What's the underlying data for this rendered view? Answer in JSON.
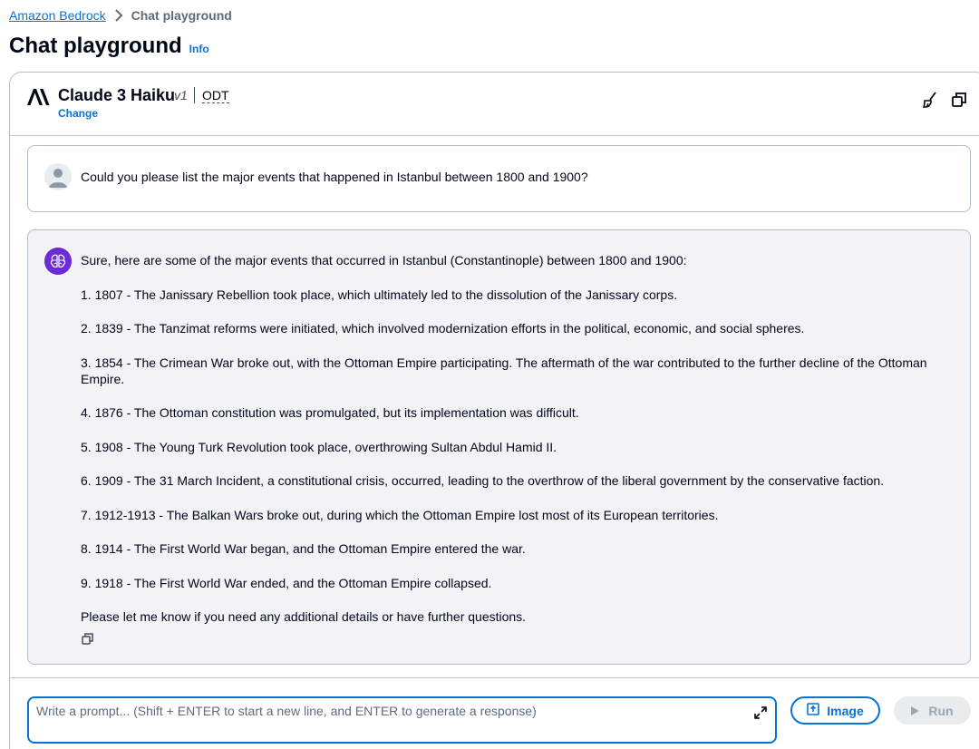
{
  "breadcrumb": {
    "parent": "Amazon Bedrock",
    "current": "Chat playground"
  },
  "page": {
    "title": "Chat playground",
    "info_label": "Info"
  },
  "model": {
    "name": "Claude 3 Haiku",
    "version": "v1",
    "tag": "ODT",
    "change_label": "Change",
    "icons": [
      "anthropic-logo",
      "broom-clear-icon",
      "copy-icon"
    ]
  },
  "conversation": {
    "user_message": "Could you please list the major events that happened in Istanbul between 1800 and 1900?",
    "assistant_intro": "Sure, here are some of the major events that occurred in Istanbul (Constantinople) between 1800 and 1900:",
    "assistant_items": [
      "1. 1807 - The Janissary Rebellion took place, which ultimately led to the dissolution of the Janissary corps.",
      "2. 1839 - The Tanzimat reforms were initiated, which involved modernization efforts in the political, economic, and social spheres.",
      "3. 1854 - The Crimean War broke out, with the Ottoman Empire participating. The aftermath of the war contributed to the further decline of the Ottoman Empire.",
      "4. 1876 - The Ottoman constitution was promulgated, but its implementation was difficult.",
      "5. 1908 - The Young Turk Revolution took place, overthrowing Sultan Abdul Hamid II.",
      "6. 1909 - The 31 March Incident, a constitutional crisis, occurred, leading to the overthrow of the liberal government by the conservative faction.",
      "7. 1912-1913 - The Balkan Wars broke out, during which the Ottoman Empire lost most of its European territories.",
      "8. 1914 - The First World War began, and the Ottoman Empire entered the war.",
      "9. 1918 - The First World War ended, and the Ottoman Empire collapsed."
    ],
    "assistant_outro": "Please let me know if you need any additional details or have further questions."
  },
  "prompt": {
    "placeholder": "Write a prompt... (Shift + ENTER to start a new line, and ENTER to generate a response)",
    "value": ""
  },
  "actions": {
    "image_label": "Image",
    "run_label": "Run"
  },
  "colors": {
    "link": "#0972d3",
    "assistant_avatar": "#6c2bd9",
    "assistant_bg": "#f3f3f7",
    "disabled_text": "#9ba7b6"
  }
}
